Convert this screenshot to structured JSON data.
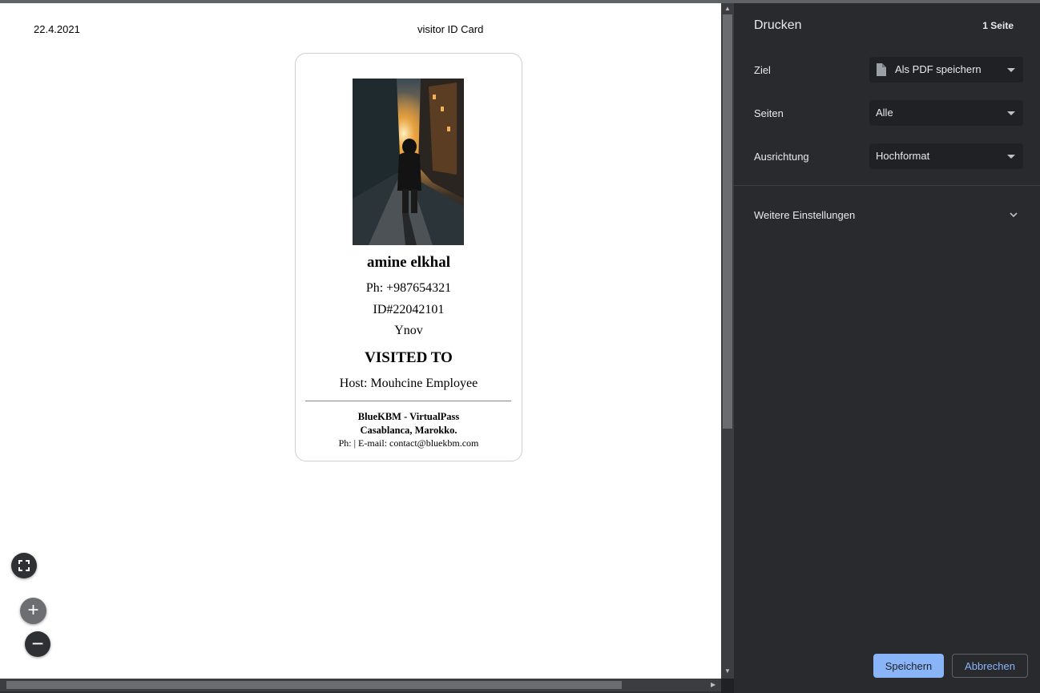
{
  "preview": {
    "header_date": "22.4.2021",
    "header_title": "visitor ID Card",
    "card": {
      "name": "amine elkhal",
      "phone": "Ph: +987654321",
      "id": "ID#22042101",
      "organization": "Ynov",
      "visited_heading": "VISITED TO",
      "host": "Host: Mouhcine Employee",
      "company": "BlueKBM - VirtualPass",
      "city": "Casablanca, Marokko.",
      "contact": "Ph: | E-mail: contact@bluekbm.com"
    }
  },
  "controls": {
    "fit_icon": "fullscreen-icon",
    "zoom_in_label": "+",
    "zoom_out_label": "−"
  },
  "print_panel": {
    "title": "Drucken",
    "page_count": "1 Seite",
    "destination": {
      "label": "Ziel",
      "value": "Als PDF speichern",
      "icon": "document-icon"
    },
    "pages": {
      "label": "Seiten",
      "value": "Alle"
    },
    "orientation": {
      "label": "Ausrichtung",
      "value": "Hochformat"
    },
    "more_settings": "Weitere Einstellungen",
    "save_label": "Speichern",
    "cancel_label": "Abbrechen"
  },
  "colors": {
    "panel_bg": "#292a2d",
    "select_bg": "#202124",
    "accent": "#8ab4f8",
    "preview_bg": "#ffffff"
  }
}
